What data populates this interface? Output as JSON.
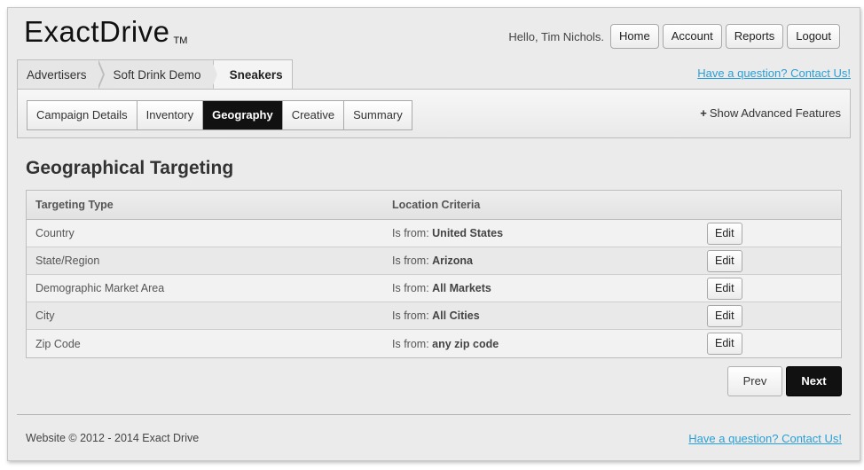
{
  "app": {
    "logo": "ExactDrive",
    "trademark": "TM"
  },
  "header": {
    "greeting": "Hello, Tim Nichols.",
    "nav": [
      "Home",
      "Account",
      "Reports",
      "Logout"
    ]
  },
  "breadcrumb": [
    "Advertisers",
    "Soft Drink Demo",
    "Sneakers"
  ],
  "contact_link": "Have a question? Contact Us!",
  "tabs": [
    "Campaign Details",
    "Inventory",
    "Geography",
    "Creative",
    "Summary"
  ],
  "active_tab": "Geography",
  "advanced": {
    "icon": "plus-icon",
    "label": "Show Advanced Features"
  },
  "page_title": "Geographical Targeting",
  "table": {
    "headers": [
      "Targeting Type",
      "Location Criteria"
    ],
    "prefix": "Is from:",
    "edit_label": "Edit",
    "rows": [
      {
        "type": "Country",
        "value": "United States"
      },
      {
        "type": "State/Region",
        "value": "Arizona"
      },
      {
        "type": "Demographic Market Area",
        "value": "All Markets"
      },
      {
        "type": "City",
        "value": "All Cities"
      },
      {
        "type": "Zip Code",
        "value": "any zip code"
      }
    ]
  },
  "pager": {
    "prev": "Prev",
    "next": "Next"
  },
  "footer": {
    "text": "Website © 2012 - 2014 Exact Drive",
    "contact": "Have a question? Contact Us!"
  },
  "colors": {
    "link": "#2a9fd6",
    "active_tab_bg": "#111111",
    "background": "#ebebeb"
  }
}
